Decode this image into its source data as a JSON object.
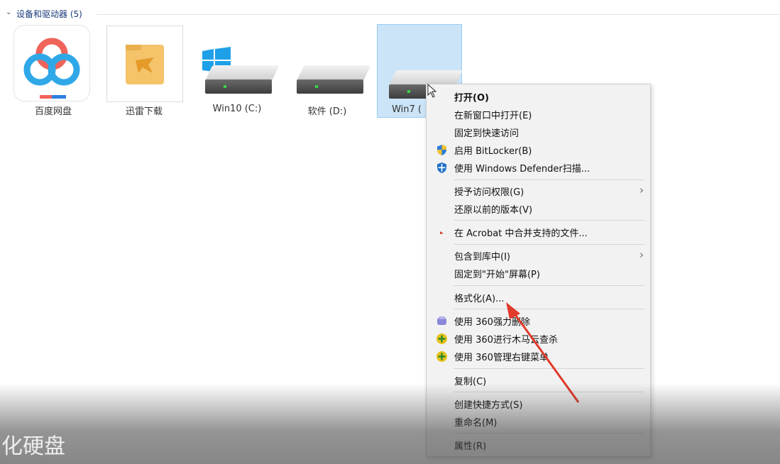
{
  "section": {
    "title": "设备和驱动器 (5)",
    "chevron": "⌄"
  },
  "tiles": [
    {
      "label": "百度网盘",
      "icon": "baidu-netdisk-icon"
    },
    {
      "label": "迅雷下载",
      "icon": "thunder-folder-icon"
    },
    {
      "label": "Win10 (C:)",
      "icon": "windows-drive-icon"
    },
    {
      "label": "软件 (D:)",
      "icon": "drive-icon"
    },
    {
      "label": "Win7 (",
      "icon": "drive-icon",
      "selected": true
    }
  ],
  "menu": {
    "items": [
      {
        "label": "打开(O)",
        "bold": true
      },
      {
        "label": "在新窗口中打开(E)"
      },
      {
        "label": "固定到快速访问"
      },
      {
        "label": "启用 BitLocker(B)",
        "icon": "shield-icon"
      },
      {
        "label": "使用 Windows Defender扫描...",
        "icon": "defender-icon"
      },
      {
        "label": "授予访问权限(G)",
        "submenu": true
      },
      {
        "label": "还原以前的版本(V)"
      },
      {
        "label": "在 Acrobat 中合并支持的文件...",
        "icon": "acrobat-icon"
      },
      {
        "label": "包含到库中(I)",
        "submenu": true
      },
      {
        "label": "固定到\"开始\"屏幕(P)"
      },
      {
        "label": "格式化(A)..."
      },
      {
        "label": "使用 360强力删除",
        "icon": "360-delete-icon"
      },
      {
        "label": "使用 360进行木马云查杀",
        "icon": "360-scan-icon"
      },
      {
        "label": "使用 360管理右键菜单",
        "icon": "360-menu-icon"
      },
      {
        "label": "复制(C)"
      },
      {
        "label": "创建快捷方式(S)"
      },
      {
        "label": "重命名(M)"
      },
      {
        "label": "属性(R)"
      }
    ],
    "submenu_glyph": "›"
  },
  "caption": "化硬盘",
  "colors": {
    "selection": "#cce4f7",
    "arrow": "#e03a2a",
    "menu_bg": "#f2f2f2"
  }
}
